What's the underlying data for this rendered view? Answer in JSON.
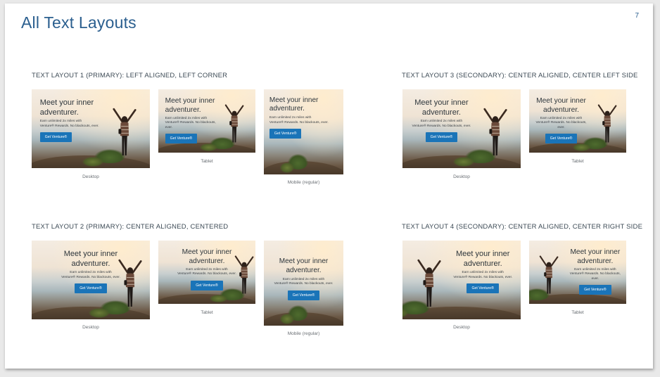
{
  "page": {
    "title": "All Text Layouts",
    "page_number": "7"
  },
  "ad": {
    "headline_line1": "Meet your inner",
    "headline_line2": "adventurer.",
    "sub_line1": "Earn unlimited 2x miles with",
    "sub_line2": "Venture® Rewards. No blackouts, ever.",
    "cta": "Get Venture®",
    "cta_color": "#1a74b8"
  },
  "sections": {
    "layout1": {
      "title": "TEXT LAYOUT 1 (PRIMARY): LEFT ALIGNED, LEFT CORNER"
    },
    "layout2": {
      "title": "TEXT LAYOUT 2 (PRIMARY): CENTER ALIGNED, CENTERED"
    },
    "layout3": {
      "title": "TEXT LAYOUT 3 (SECONDARY): CENTER ALIGNED, CENTER LEFT SIDE"
    },
    "layout4": {
      "title": "TEXT LAYOUT 4 (SECONDARY): CENTER ALIGNED, CENTER RIGHT SIDE"
    }
  },
  "captions": {
    "desktop": "Desktop",
    "tablet": "Tablet",
    "mobile": "Mobile (regular)"
  },
  "colors": {
    "title": "#2b5f8f",
    "section_title": "#3c4a55",
    "caption": "#6a6f74"
  }
}
